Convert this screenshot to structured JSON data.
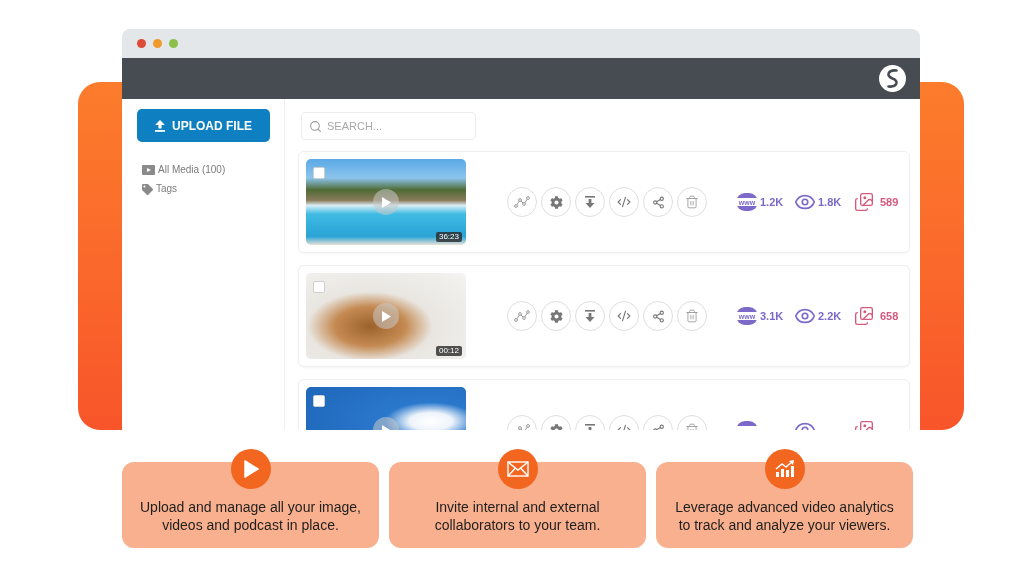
{
  "browser": {
    "sidebar": {
      "upload_button": "UPLOAD FILE",
      "items": [
        {
          "kind": "media",
          "label": "All Media (100)"
        },
        {
          "kind": "tags",
          "label": "Tags"
        }
      ]
    },
    "search": {
      "placeholder": "SEARCH..."
    },
    "media": [
      {
        "checked": false,
        "duration": "36:23",
        "stats": [
          {
            "kind": "web",
            "badge": "www",
            "value": "1.2K"
          },
          {
            "kind": "views",
            "value": "1.8K"
          },
          {
            "kind": "images",
            "value": "589"
          }
        ]
      },
      {
        "checked": false,
        "duration": "00:12",
        "stats": [
          {
            "kind": "web",
            "badge": "www",
            "value": "3.1K"
          },
          {
            "kind": "views",
            "value": "2.2K"
          },
          {
            "kind": "images",
            "value": "658"
          }
        ]
      },
      {
        "checked": false,
        "stats": [
          {
            "kind": "web"
          },
          {
            "kind": "views"
          },
          {
            "kind": "images"
          }
        ]
      }
    ]
  },
  "features": [
    {
      "kind": "play",
      "lines": [
        "Upload and manage all your image,",
        "videos and podcast in place."
      ]
    },
    {
      "kind": "mail",
      "lines": [
        "Invite internal and external",
        "collaborators to your team."
      ]
    },
    {
      "kind": "chart",
      "lines": [
        "Leverage advanced video analytics",
        "to track and analyze your viewers."
      ]
    }
  ]
}
